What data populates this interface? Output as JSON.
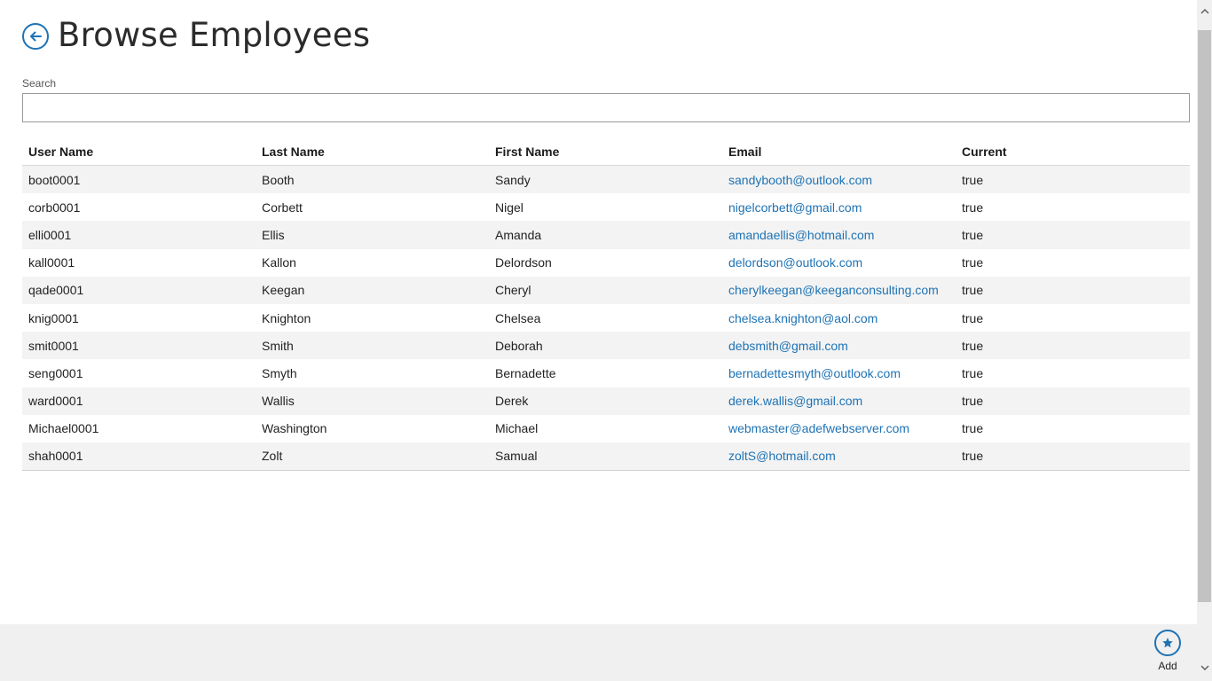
{
  "header": {
    "title": "Browse Employees"
  },
  "search": {
    "label": "Search",
    "value": "",
    "placeholder": ""
  },
  "table": {
    "columns": [
      "User Name",
      "Last Name",
      "First Name",
      "Email",
      "Current"
    ],
    "rows": [
      {
        "user": "boot0001",
        "last": "Booth",
        "first": "Sandy",
        "email": "sandybooth@outlook.com",
        "current": "true"
      },
      {
        "user": "corb0001",
        "last": "Corbett",
        "first": "Nigel",
        "email": "nigelcorbett@gmail.com",
        "current": "true"
      },
      {
        "user": "elli0001",
        "last": "Ellis",
        "first": "Amanda",
        "email": "amandaellis@hotmail.com",
        "current": "true"
      },
      {
        "user": "kall0001",
        "last": "Kallon",
        "first": "Delordson",
        "email": "delordson@outlook.com",
        "current": "true"
      },
      {
        "user": "qade0001",
        "last": "Keegan",
        "first": "Cheryl",
        "email": "cherylkeegan@keeganconsulting.com",
        "current": "true"
      },
      {
        "user": "knig0001",
        "last": "Knighton",
        "first": "Chelsea",
        "email": "chelsea.knighton@aol.com",
        "current": "true"
      },
      {
        "user": "smit0001",
        "last": "Smith",
        "first": "Deborah",
        "email": "debsmith@gmail.com",
        "current": "true"
      },
      {
        "user": "seng0001",
        "last": "Smyth",
        "first": "Bernadette",
        "email": "bernadettesmyth@outlook.com",
        "current": "true"
      },
      {
        "user": "ward0001",
        "last": "Wallis",
        "first": "Derek",
        "email": "derek.wallis@gmail.com",
        "current": "true"
      },
      {
        "user": "Michael0001",
        "last": "Washington",
        "first": "Michael",
        "email": "webmaster@adefwebserver.com",
        "current": "true"
      },
      {
        "user": "shah0001",
        "last": "Zolt",
        "first": "Samual",
        "email": "zoltS@hotmail.com",
        "current": "true"
      }
    ]
  },
  "app_bar": {
    "add_label": "Add"
  },
  "icons": {
    "back": "back-arrow-icon",
    "add": "star-icon",
    "scroll_up": "chevron-up-icon",
    "scroll_down": "chevron-down-icon"
  },
  "colors": {
    "accent": "#1e73b5",
    "row_alt": "#f3f3f3",
    "app_bar": "#f0f0f0"
  }
}
